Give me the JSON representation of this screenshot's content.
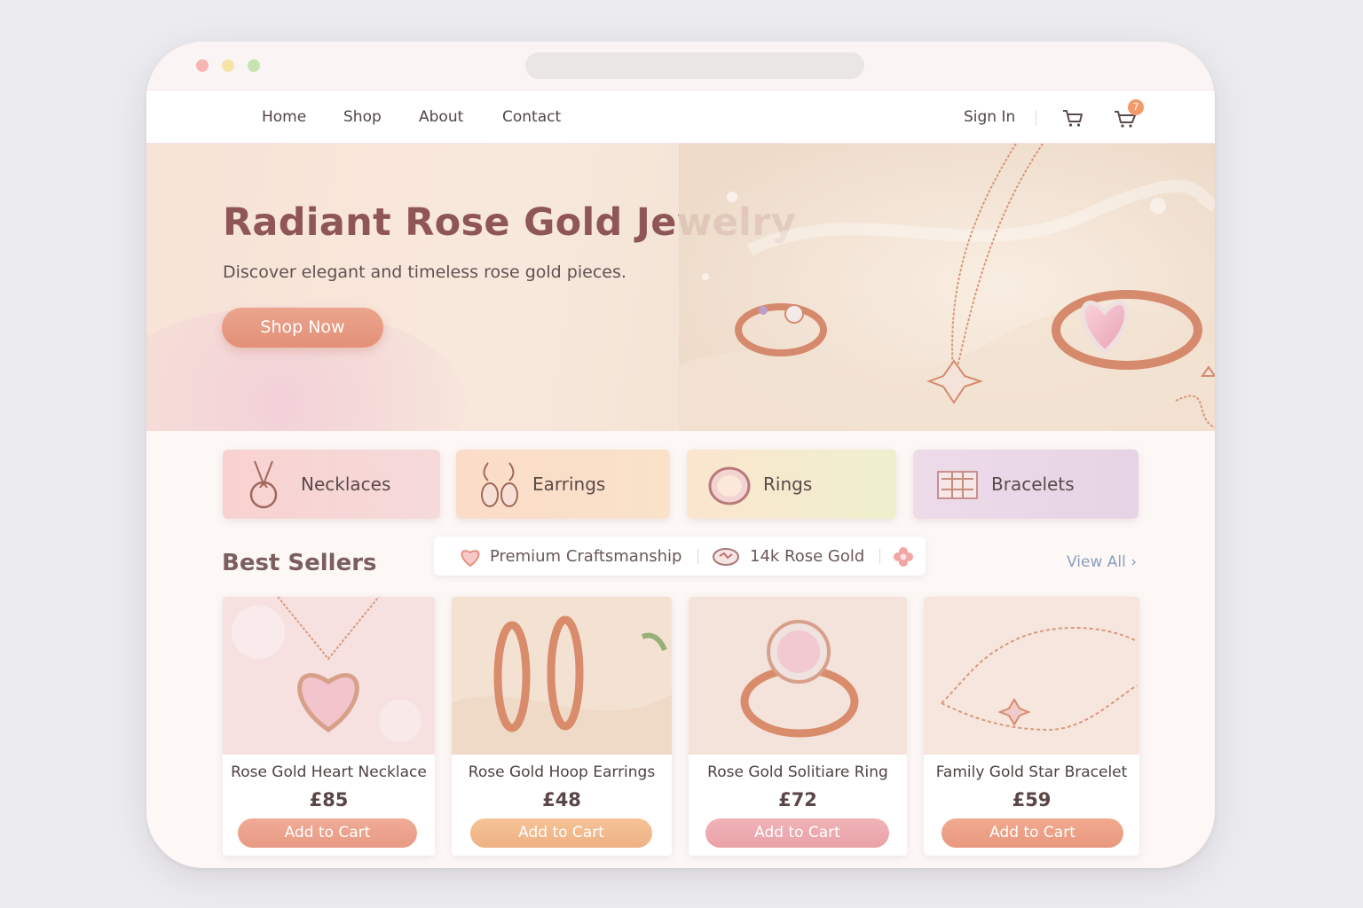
{
  "nav": {
    "links": [
      "Home",
      "Shop",
      "About",
      "Contact"
    ],
    "sign_in": "Sign In",
    "cart_badge": "7"
  },
  "hero": {
    "title": "Radiant Rose Gold Jewelry",
    "subtitle": "Discover elegant and timeless rose gold pieces.",
    "cta": "Shop Now"
  },
  "categories": [
    {
      "label": "Necklaces",
      "icon": "necklace-icon"
    },
    {
      "label": "Earrings",
      "icon": "earrings-icon"
    },
    {
      "label": "Rings",
      "icon": "ring-icon"
    },
    {
      "label": "Bracelets",
      "icon": "bracelet-icon"
    }
  ],
  "best_sellers": {
    "title": "Best Sellers",
    "view_all": "View All ›",
    "features": [
      {
        "label": "Premium Craftsmanship",
        "icon": "heart-icon"
      },
      {
        "label": "14k Rose Gold",
        "icon": "gem-icon"
      },
      {
        "label": "",
        "icon": "flower-icon"
      }
    ]
  },
  "products": [
    {
      "name": "Rose Gold Heart Necklace",
      "price": "£85",
      "button": "Add to Cart"
    },
    {
      "name": "Rose Gold Hoop Earrings",
      "price": "£48",
      "button": "Add to Cart"
    },
    {
      "name": "Rose Gold Solitiare Ring",
      "price": "£72",
      "button": "Add to Cart"
    },
    {
      "name": "Family Gold Star Bracelet",
      "price": "£59",
      "button": "Add to Cart"
    }
  ],
  "colors": {
    "accent": "#e79a84",
    "title": "#8e5656",
    "link": "#8a9ec0",
    "badge": "#f39a6a"
  }
}
